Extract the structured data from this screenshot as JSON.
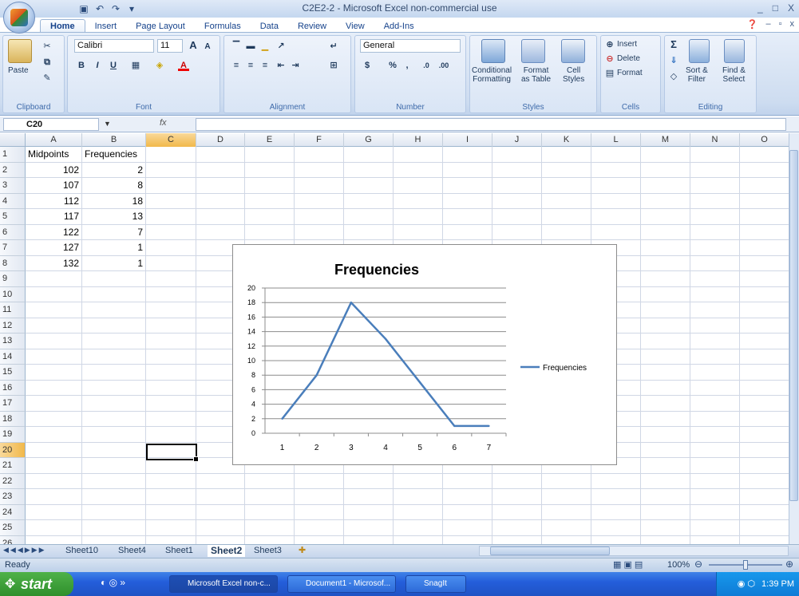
{
  "window": {
    "title": "C2E2-2 - Microsoft Excel non-commercial use",
    "controls": [
      "_",
      "□",
      "X"
    ]
  },
  "ribbon": {
    "tabs": [
      "Home",
      "Insert",
      "Page Layout",
      "Formulas",
      "Data",
      "Review",
      "View",
      "Add-Ins"
    ],
    "active_tab": "Home",
    "groups": {
      "clipboard": {
        "label": "Clipboard",
        "paste": "Paste"
      },
      "font": {
        "label": "Font",
        "font_name": "Calibri",
        "font_size": "11"
      },
      "alignment": {
        "label": "Alignment"
      },
      "number": {
        "label": "Number",
        "format": "General",
        "dollar": "$",
        "percent": "%",
        "comma": ","
      },
      "styles": {
        "label": "Styles",
        "conditional": "Conditional\nFormatting",
        "format_table": "Format\nas Table",
        "cell_styles": "Cell\nStyles"
      },
      "cells": {
        "label": "Cells",
        "insert": "Insert",
        "delete": "Delete",
        "format": "Format"
      },
      "editing": {
        "label": "Editing",
        "sort": "Sort &\nFilter",
        "find": "Find &\nSelect"
      }
    }
  },
  "formula_bar": {
    "name_box": "C20",
    "fx": "fx",
    "value": ""
  },
  "grid": {
    "columns": [
      "A",
      "B",
      "C",
      "D",
      "E",
      "F",
      "G",
      "H",
      "I",
      "J",
      "K",
      "L",
      "M",
      "N",
      "O"
    ],
    "rows": [
      "1",
      "2",
      "3",
      "4",
      "5",
      "6",
      "7",
      "8",
      "9",
      "10",
      "11",
      "12",
      "13",
      "14",
      "15",
      "16",
      "17",
      "18",
      "19",
      "20",
      "21",
      "22",
      "23",
      "24",
      "25",
      "26"
    ],
    "selected_col": "C",
    "selected_row": "20",
    "cells": {
      "A1": "Midpoints",
      "B1": "Frequencies",
      "A2": "102",
      "B2": "2",
      "A3": "107",
      "B3": "8",
      "A4": "112",
      "B4": "18",
      "A5": "117",
      "B5": "13",
      "A6": "122",
      "B6": "7",
      "A7": "127",
      "B7": "1",
      "A8": "132",
      "B8": "1"
    }
  },
  "chart_data": {
    "type": "line",
    "title": "Frequencies",
    "categories": [
      "1",
      "2",
      "3",
      "4",
      "5",
      "6",
      "7"
    ],
    "series": [
      {
        "name": "Frequencies",
        "values": [
          2,
          8,
          18,
          13,
          7,
          1,
          1
        ],
        "color": "#4a7ebb"
      }
    ],
    "ylim": [
      0,
      20
    ],
    "yticks": [
      "0",
      "2",
      "4",
      "6",
      "8",
      "10",
      "12",
      "14",
      "16",
      "18",
      "20"
    ],
    "grid": true,
    "legend": "right"
  },
  "sheet_tabs": {
    "tabs": [
      "Sheet10",
      "Sheet4",
      "Sheet1",
      "Sheet2",
      "Sheet3"
    ],
    "active": "Sheet2"
  },
  "status": {
    "text": "Ready",
    "zoom": "100%"
  },
  "taskbar": {
    "start": "start",
    "tasks": [
      "Microsoft Excel non-c...",
      "Document1 - Microsof...",
      "SnagIt"
    ],
    "clock": "1:39 PM"
  }
}
